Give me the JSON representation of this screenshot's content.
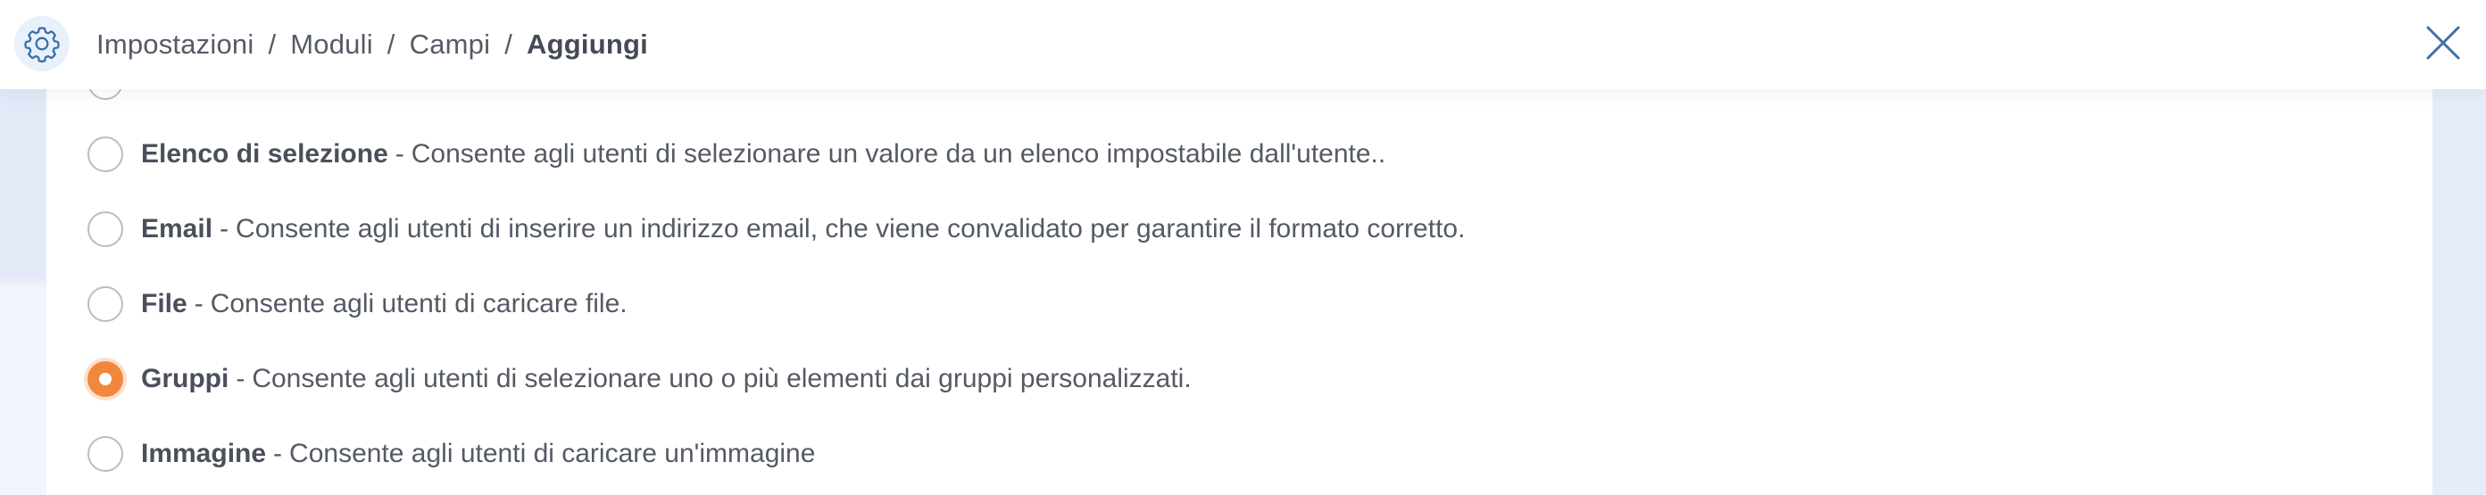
{
  "breadcrumb": {
    "items": [
      "Impostazioni",
      "Moduli",
      "Campi"
    ],
    "current": "Aggiungi",
    "separator": "/"
  },
  "options": [
    {
      "name": "Elenco di selezione",
      "description": "Consente agli utenti di selezionare un valore da un elenco impostabile dall'utente..",
      "selected": false
    },
    {
      "name": "Email",
      "description": "Consente agli utenti di inserire un indirizzo email, che viene convalidato per garantire il formato corretto.",
      "selected": false
    },
    {
      "name": "File",
      "description": "Consente agli utenti di caricare file.",
      "selected": false
    },
    {
      "name": "Gruppi",
      "description": "Consente agli utenti di selezionare uno o più elementi dai gruppi personalizzati.",
      "selected": true
    },
    {
      "name": "Immagine",
      "description": "Consente agli utenti di caricare un'immagine",
      "selected": false
    }
  ],
  "icons": {
    "header": "gear-icon",
    "close": "close-icon"
  },
  "colors": {
    "accent": "#f1873d",
    "close_icon": "#3f6fa6",
    "gear_icon": "#3f6fa6"
  }
}
